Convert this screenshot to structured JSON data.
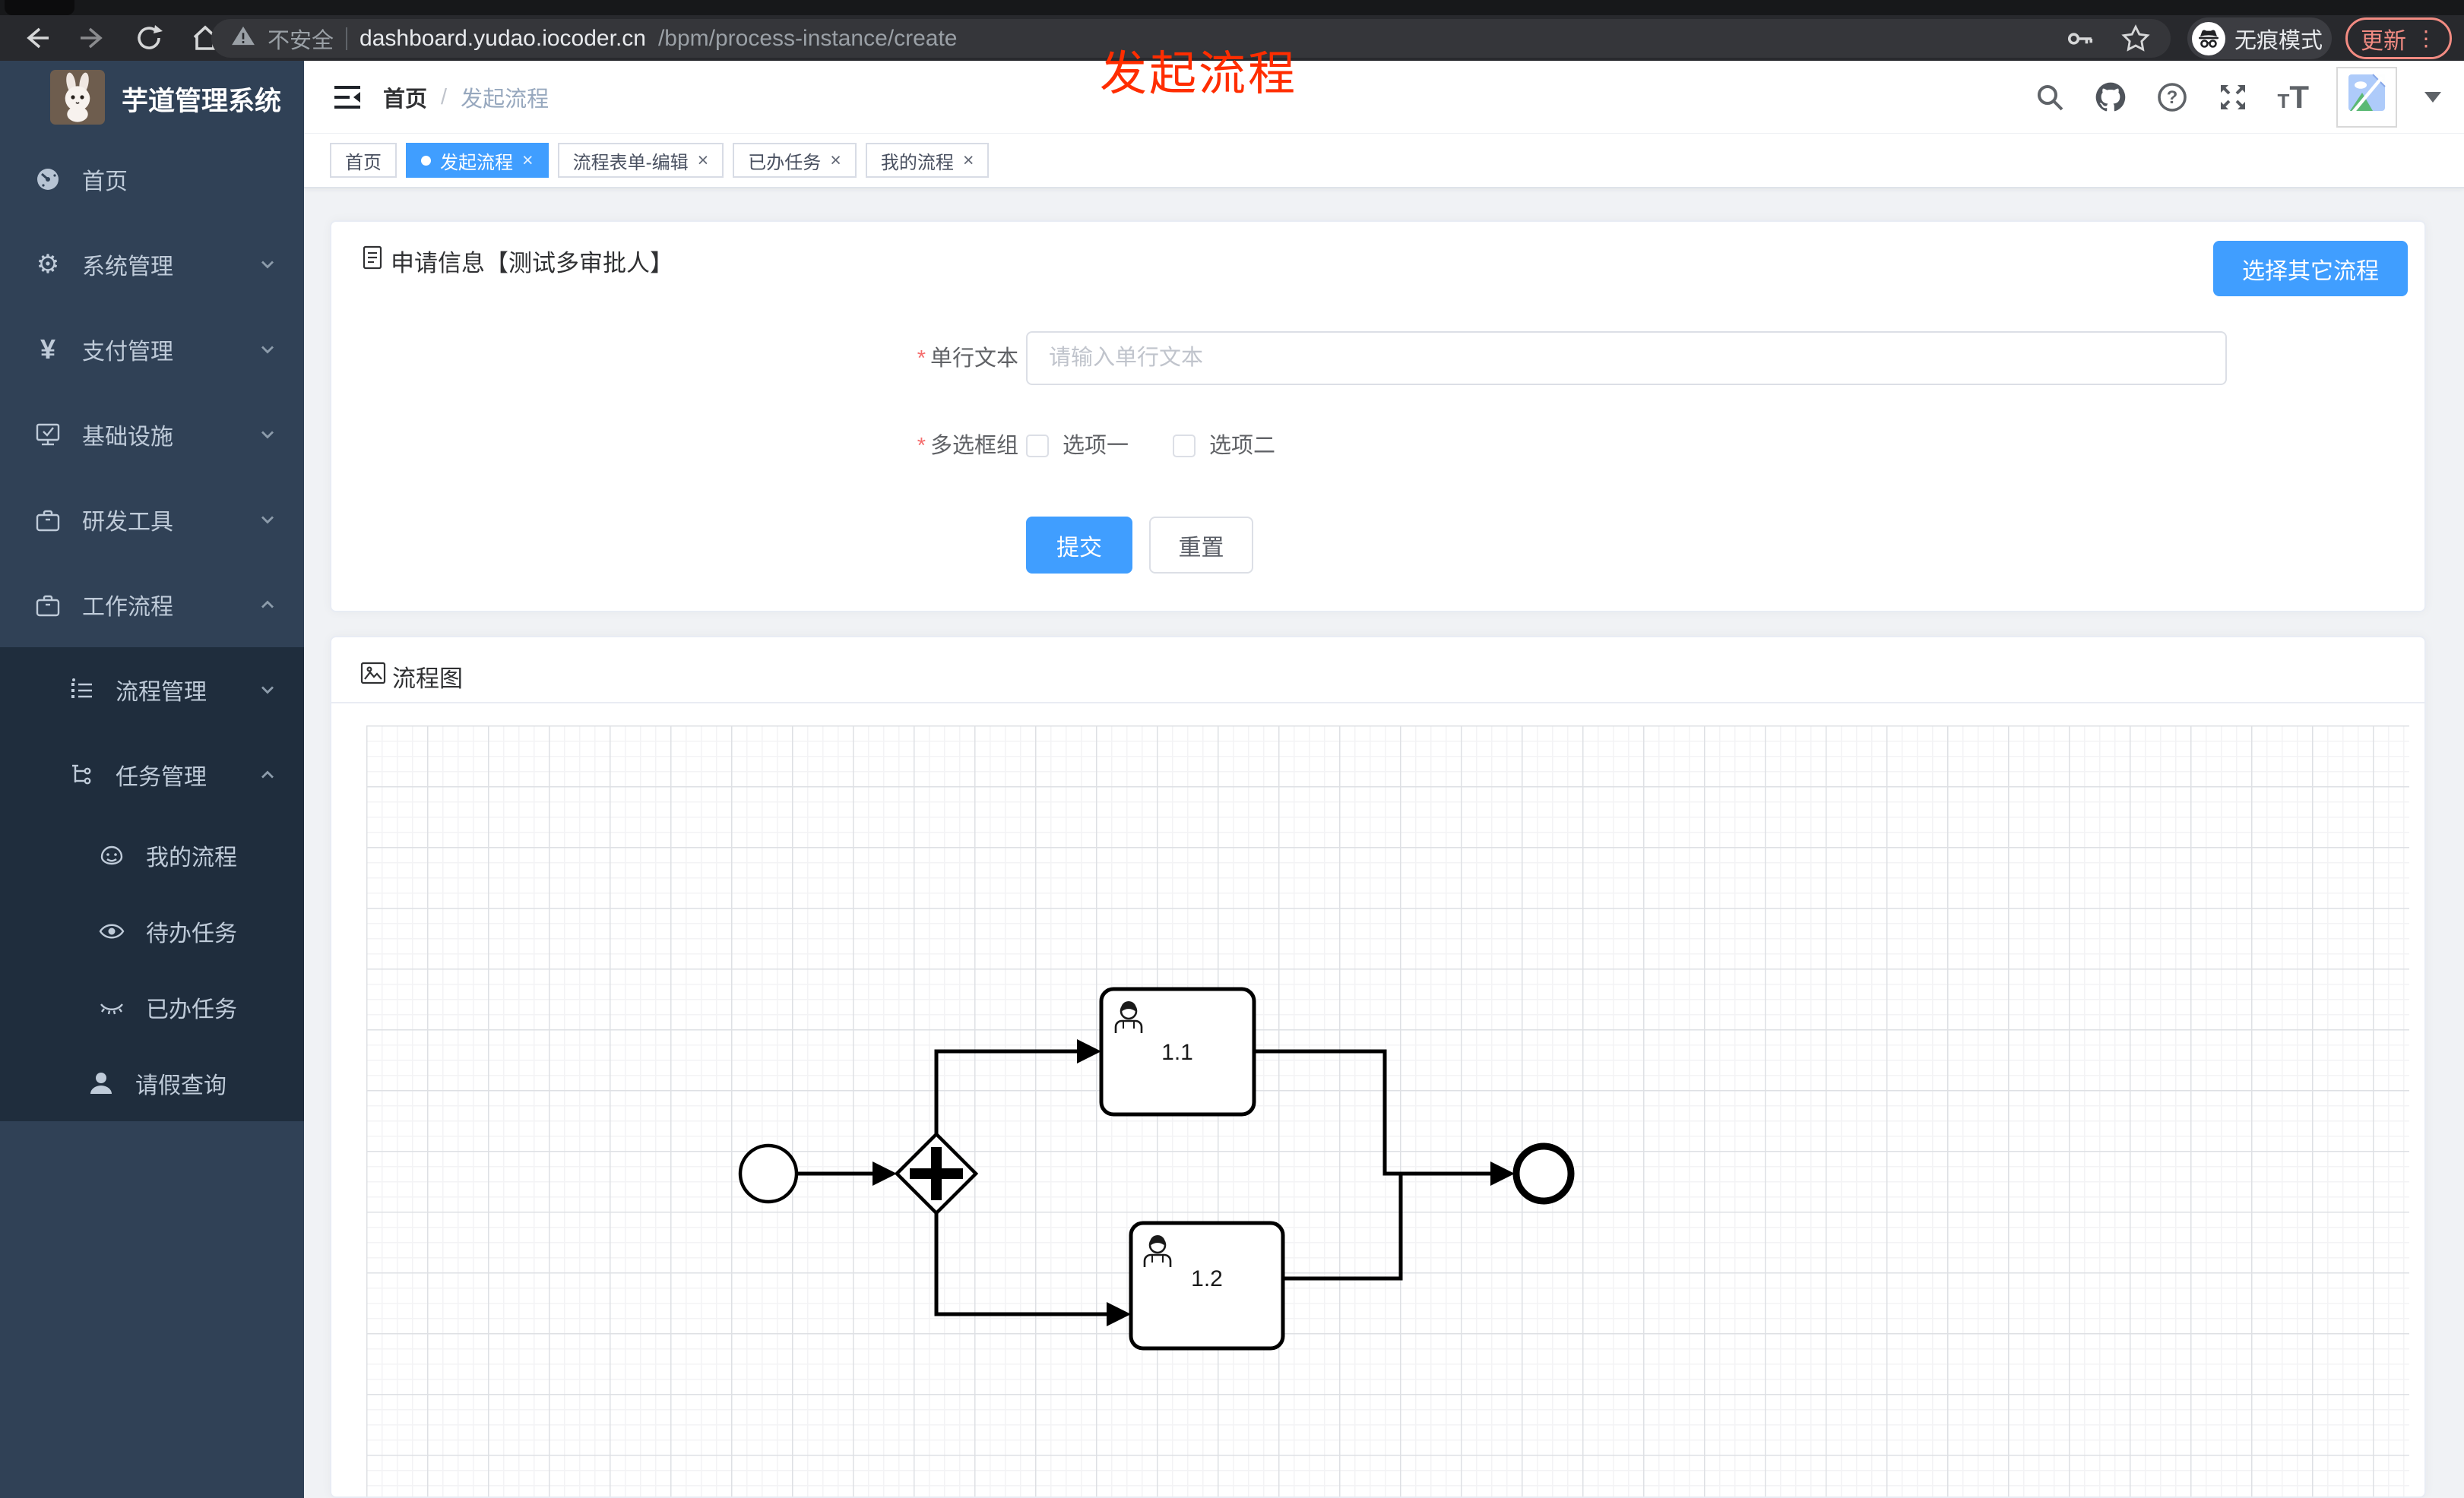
{
  "browser": {
    "security_label": "不安全",
    "url_domain": "dashboard.yudao.iocoder.cn",
    "url_path": "/bpm/process-instance/create",
    "incognito_label": "无痕模式",
    "update_label": "更新",
    "menu_dots": "⋮"
  },
  "annotation": {
    "text": "发起流程",
    "color": "#ff2d00"
  },
  "sidebar": {
    "title": "芋道管理系统",
    "items": [
      {
        "label": "首页"
      },
      {
        "label": "系统管理",
        "chevron": "down"
      },
      {
        "label": "支付管理",
        "chevron": "down"
      },
      {
        "label": "基础设施",
        "chevron": "down"
      },
      {
        "label": "研发工具",
        "chevron": "down"
      },
      {
        "label": "工作流程",
        "chevron": "up"
      },
      {
        "label": "流程管理",
        "chevron": "down"
      },
      {
        "label": "任务管理",
        "chevron": "up"
      },
      {
        "label": "我的流程"
      },
      {
        "label": "待办任务"
      },
      {
        "label": "已办任务"
      },
      {
        "label": "请假查询"
      }
    ]
  },
  "header": {
    "breadcrumb": [
      "首页",
      "发起流程"
    ],
    "separator": "/"
  },
  "tabs": {
    "close_glyph": "×",
    "items": [
      {
        "label": "首页",
        "active": false,
        "closable": false
      },
      {
        "label": "发起流程",
        "active": true,
        "closable": true
      },
      {
        "label": "流程表单-编辑",
        "active": false,
        "closable": true
      },
      {
        "label": "已办任务",
        "active": false,
        "closable": true
      },
      {
        "label": "我的流程",
        "active": false,
        "closable": true
      }
    ]
  },
  "apply_card": {
    "title": "申请信息【测试多审批人】",
    "choose_button": "选择其它流程",
    "required_mark": "*",
    "fields": [
      {
        "label": "单行文本",
        "placeholder": "请输入单行文本",
        "value": ""
      },
      {
        "label": "多选框组",
        "options": [
          {
            "label": "选项一",
            "checked": false
          },
          {
            "label": "选项二",
            "checked": false
          }
        ]
      }
    ],
    "submit_label": "提交",
    "reset_label": "重置"
  },
  "diagram_card": {
    "title": "流程图",
    "nodes": {
      "start": "start-event",
      "gateway": "parallel-gateway",
      "task1": "1.1",
      "task2": "1.2",
      "end": "end-event"
    }
  },
  "colors": {
    "primary": "#409eff",
    "annotation_red": "#ff2d00",
    "sidebar_bg": "#304156",
    "sidebar_submenu_bg": "#1f2d3d",
    "sidebar_text": "#bfcbd9",
    "content_bg": "#f0f2f5",
    "update_button": "#f28b82"
  }
}
